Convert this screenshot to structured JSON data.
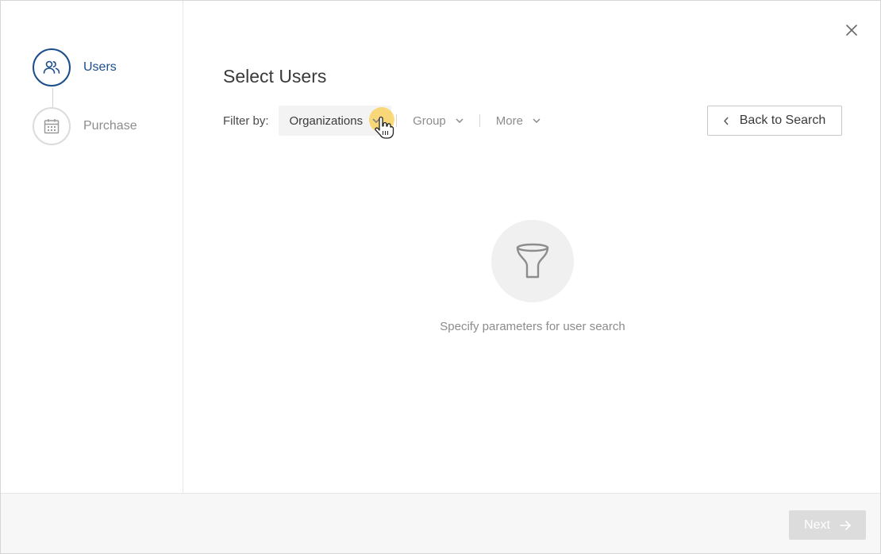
{
  "sidebar": {
    "steps": [
      {
        "label": "Users",
        "icon": "users-icon",
        "state": "active"
      },
      {
        "label": "Purchase",
        "icon": "calendar-icon",
        "state": "inactive"
      }
    ]
  },
  "main": {
    "title": "Select Users",
    "filter_label": "Filter by:",
    "filters": [
      {
        "label": "Organizations",
        "selected": true
      },
      {
        "label": "Group",
        "selected": false
      },
      {
        "label": "More",
        "selected": false
      }
    ],
    "back_button_label": "Back to Search",
    "empty_state": {
      "icon": "funnel-icon",
      "text": "Specify parameters for user search"
    }
  },
  "footer": {
    "next_label": "Next"
  },
  "colors": {
    "accent": "#1c4e8c",
    "muted_text": "#8c8c8c",
    "disabled_button": "#dcdcdc",
    "cursor_highlight": "#facd50"
  }
}
